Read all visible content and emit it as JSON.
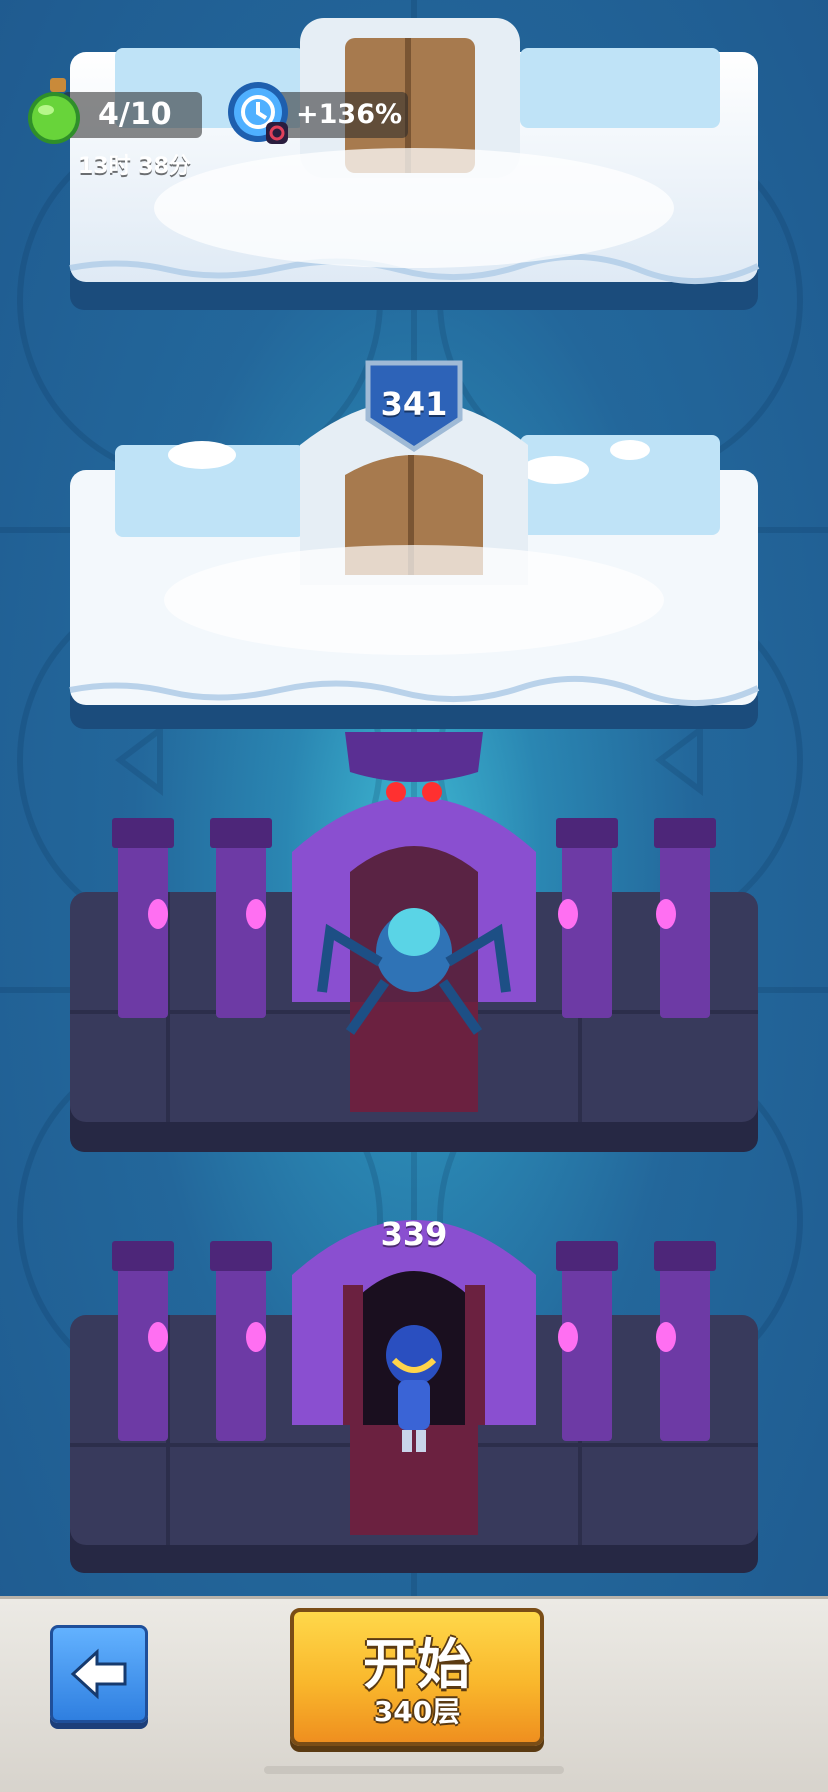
{
  "hud": {
    "energy_count": "4/10",
    "energy_timer": "13时 38分",
    "bonus_percent": "+136%",
    "energy_icon": "potion-icon",
    "bonus_icon": "clock-refresh-icon"
  },
  "floors": {
    "locked_upper": {
      "state": "locked-ice"
    },
    "locked_next": {
      "number": "341",
      "state": "locked-ice"
    },
    "current": {
      "state": "dungeon-with-boss",
      "enemy": "spider-monster"
    },
    "cleared": {
      "number": "339",
      "state": "dungeon-open-door",
      "hero": "knight-hero"
    }
  },
  "footer": {
    "start_label": "开始",
    "start_floor": "340层",
    "back_icon": "arrow-left-icon"
  },
  "colors": {
    "background": "#23679b",
    "accent_yellow": "#f9b72c",
    "accent_purple": "#7b3fb8",
    "ice": "#eef5fb"
  }
}
